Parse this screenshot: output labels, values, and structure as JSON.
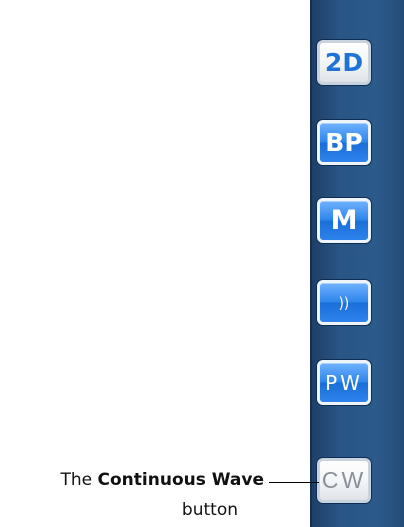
{
  "toolbar": {
    "buttons": [
      {
        "label": "2D"
      },
      {
        "label": "BP"
      },
      {
        "label": "M"
      },
      {
        "label": "))"
      },
      {
        "label": "PW"
      },
      {
        "label": "CW"
      }
    ]
  },
  "callout": {
    "prefix": "The ",
    "name": "Continuous Wave",
    "suffix": "button"
  },
  "colors": {
    "toolbar_bg": "#2a5585",
    "button_blue": "#2e86ea",
    "button_text_2d": "#1f73d6",
    "cw_text": "#8a9099"
  }
}
